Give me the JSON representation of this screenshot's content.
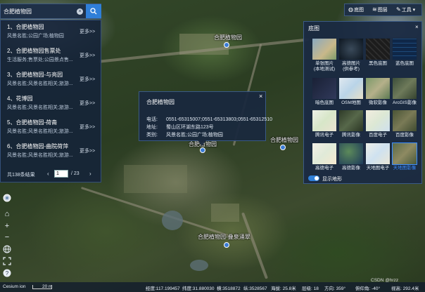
{
  "search": {
    "value": "合肥植物园",
    "clear_icon": "clear-icon",
    "button_icon": "search-icon"
  },
  "results": [
    {
      "title": "1、合肥植物园",
      "desc": "风景名胜;公园广场;植物园",
      "more": "更多>>"
    },
    {
      "title": "2、合肥植物园售票处",
      "desc": "生活服务;售票处;公园景点售...",
      "more": "更多>>"
    },
    {
      "title": "3、合肥植物园-与亮园",
      "desc": "风景名胜;风景名胜相关;旅游...",
      "more": "更多>>"
    },
    {
      "title": "4、花博园",
      "desc": "风景名胜;风景名胜相关;旅游...",
      "more": "更多>>"
    },
    {
      "title": "5、合肥植物园-荷斋",
      "desc": "风景名胜;风景名胜相关;旅游...",
      "more": "更多>>"
    },
    {
      "title": "6、合肥植物园-曲院荷萍",
      "desc": "风景名胜;风景名胜相关;旅游...",
      "more": "更多>>"
    }
  ],
  "pager": {
    "total": "共138条结果",
    "prev": "‹",
    "current": "1",
    "of": "/ 23",
    "next": "›"
  },
  "popup": {
    "title": "合肥植物园",
    "close": "×",
    "phone_label": "电话:",
    "phone": "0551-65315007;0551-65313803;0551-65312510",
    "address_label": "地址:",
    "address": "蜀山区环湖东路123号",
    "category_label": "类别:",
    "category": "风景名胜;公园广场;植物园"
  },
  "toolbar": {
    "basemap": "底图",
    "layers": "图层",
    "tools": "工具"
  },
  "basemap_panel": {
    "title": "底图",
    "close": "×",
    "tiles": [
      {
        "label": "单张图片",
        "sub": "(本地测试)",
        "selected": false
      },
      {
        "label": "高德图片",
        "sub": "(供参考)",
        "selected": false
      },
      {
        "label": "黑色底图",
        "sub": "",
        "selected": false
      },
      {
        "label": "蓝色底图",
        "sub": "",
        "selected": false
      },
      {
        "label": "暗色底图",
        "sub": "",
        "selected": false
      },
      {
        "label": "OSM地图",
        "sub": "",
        "selected": false
      },
      {
        "label": "微软影像",
        "sub": "",
        "selected": false
      },
      {
        "label": "ArcGIS影像",
        "sub": "",
        "selected": false
      },
      {
        "label": "腾讯电子",
        "sub": "",
        "selected": false
      },
      {
        "label": "腾讯影像",
        "sub": "",
        "selected": false
      },
      {
        "label": "百度电子",
        "sub": "",
        "selected": false
      },
      {
        "label": "百度影像",
        "sub": "",
        "selected": false
      },
      {
        "label": "高德电子",
        "sub": "",
        "selected": false
      },
      {
        "label": "高德影像",
        "sub": "",
        "selected": false
      },
      {
        "label": "天地图电子",
        "sub": "",
        "selected": false
      },
      {
        "label": "天地图影像",
        "sub": "",
        "selected": true
      }
    ],
    "terrain_label": "显示地形",
    "terrain_on": true
  },
  "map_labels": {
    "label_a": "合肥植物园",
    "label_b": "合肥植物园",
    "label_c": "合肥植物园",
    "label_d": "合肥植物园-叠泉涌翠"
  },
  "status": {
    "lng": "经度:117.199457",
    "lat": "纬度:31.880030",
    "x": "横:3518872",
    "y": "纵:3528567",
    "alt": "海拔: 25.8米",
    "level": "层级: 18",
    "heading": "方向: 359°",
    "pitch": "俯仰角: -40°",
    "view": "视高: 292.4米",
    "scale": "20 m",
    "credit": "Cesium ion"
  },
  "watermark": "CSDN @hrzz",
  "colors": {
    "accent": "#2f7fd8",
    "panel": "#1a2a42",
    "selected": "#3b8cff"
  }
}
